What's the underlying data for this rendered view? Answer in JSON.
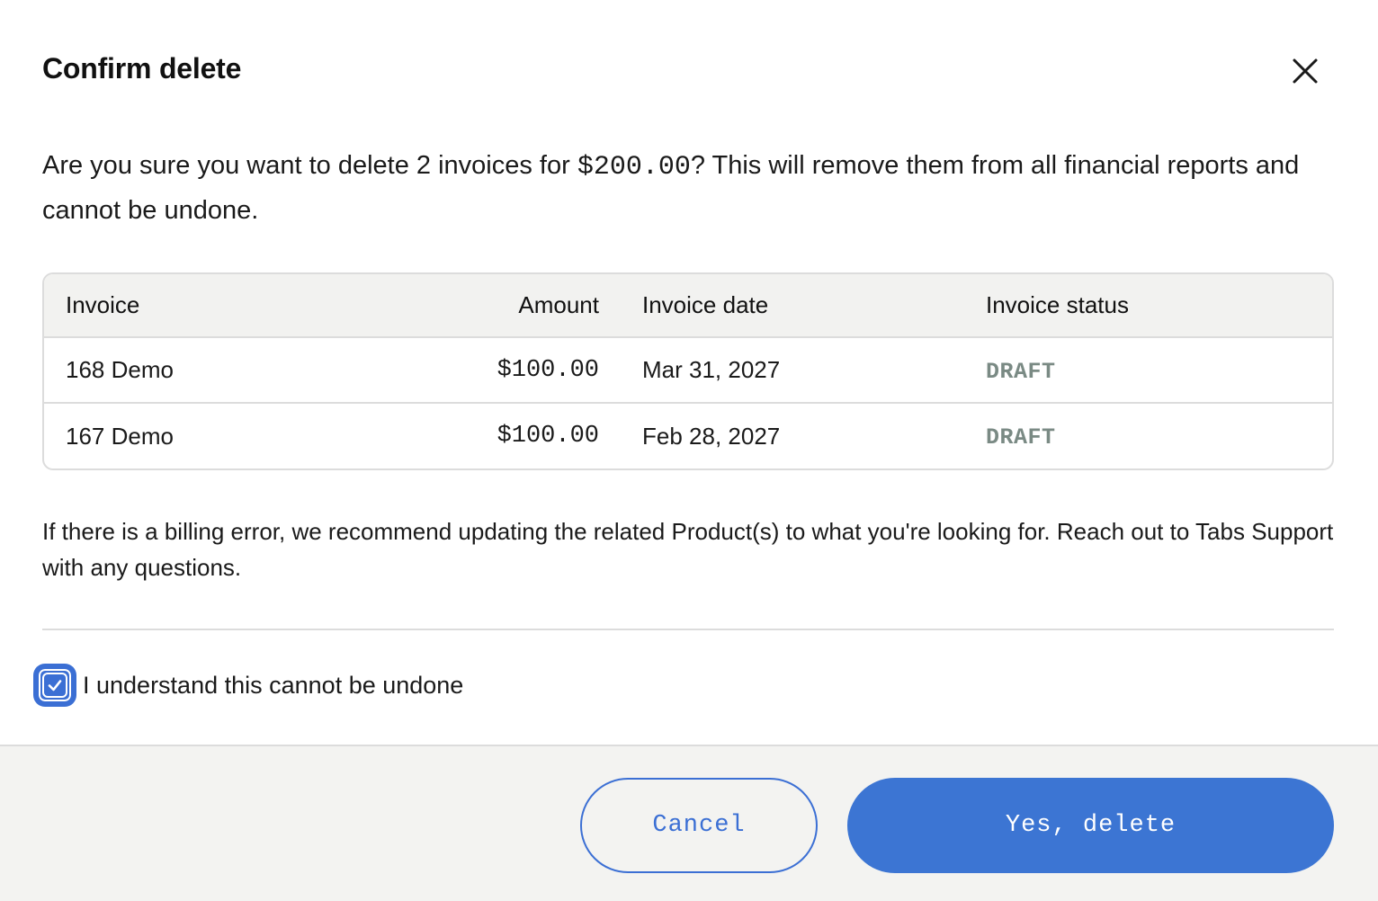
{
  "dialog": {
    "title": "Confirm delete",
    "message_before": "Are you sure you want to delete 2 invoices for ",
    "message_amount": "$200.00",
    "message_after": "? This will remove them from all financial reports and cannot be undone.",
    "note": "If there is a billing error, we recommend updating the related Product(s) to what you're looking for. Reach out to Tabs Support with any questions.",
    "acknowledge_label": "I understand this cannot be undone",
    "acknowledge_checked": true,
    "cancel_label": "Cancel",
    "confirm_label": "Yes, delete"
  },
  "table": {
    "headers": [
      "Invoice",
      "Amount",
      "Invoice date",
      "Invoice status"
    ],
    "rows": [
      {
        "invoice": "168 Demo",
        "amount": "$100.00",
        "date": "Mar 31, 2027",
        "status": "DRAFT"
      },
      {
        "invoice": "167 Demo",
        "amount": "$100.00",
        "date": "Feb 28, 2027",
        "status": "DRAFT"
      }
    ]
  },
  "colors": {
    "primary": "#3c75d3",
    "status_draft": "#7a8a84",
    "footer_bg": "#f3f3f1"
  },
  "icons": {
    "close": "close-icon",
    "check": "check-icon"
  }
}
